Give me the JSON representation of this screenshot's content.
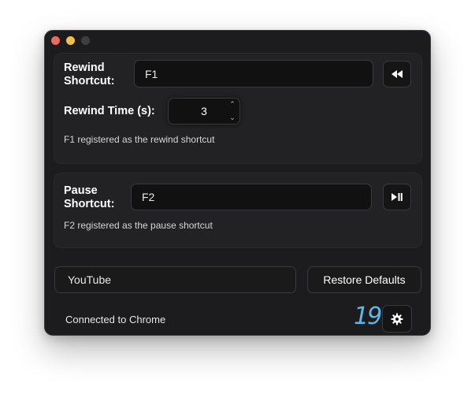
{
  "rewind": {
    "label": "Rewind\nShortcut:",
    "shortcut_value": "F1",
    "time_label": "Rewind Time (s):",
    "time_value": "3",
    "status": "F1 registered as the rewind shortcut",
    "button_icon": "rewind-icon"
  },
  "pause": {
    "label": "Pause\nShortcut:",
    "shortcut_value": "F2",
    "status": "F2 registered as the pause shortcut",
    "button_icon": "play-pause-icon"
  },
  "bottom": {
    "site_value": "YouTube",
    "restore_label": "Restore Defaults",
    "connection_status": "Connected to Chrome",
    "badge_number": "19",
    "settings_icon": "gear-icon"
  },
  "colors": {
    "window_bg": "#1c1c1e",
    "panel_bg": "#222224",
    "field_bg": "#111112",
    "accent_number": "#5ab9e8",
    "close": "#ec6a5e",
    "minimize": "#f4bf4f"
  }
}
